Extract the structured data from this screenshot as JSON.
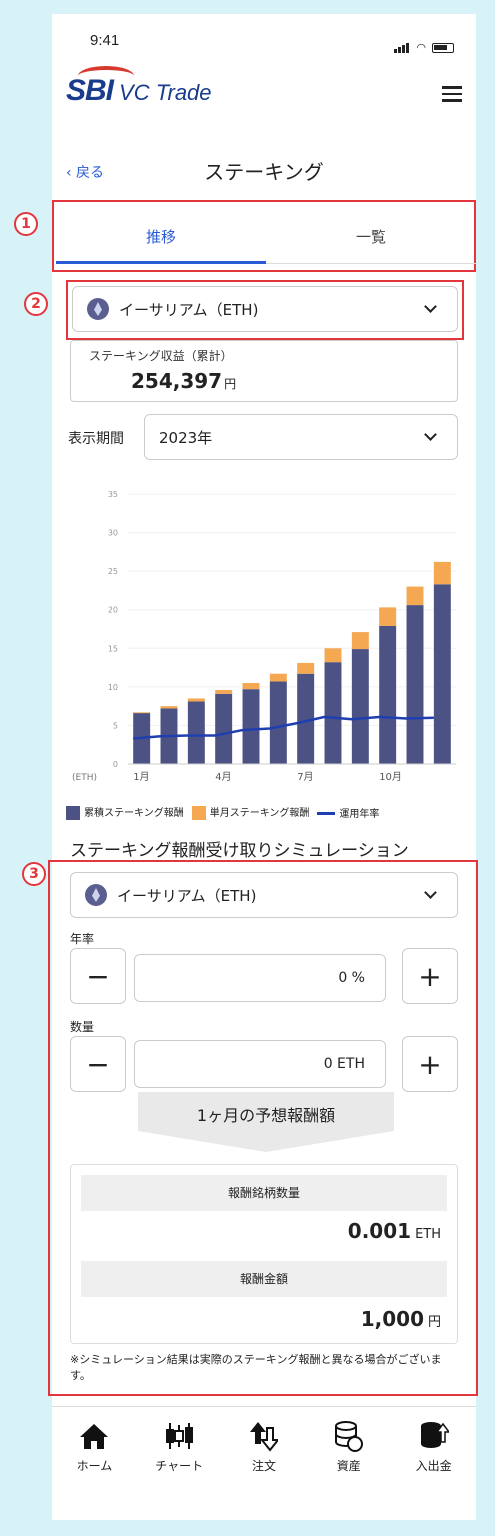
{
  "status": {
    "time": "9:41"
  },
  "header": {
    "logo_sbi": "SBI",
    "logo_product": "VC Trade"
  },
  "nav": {
    "back_label": "‹ 戻る",
    "title": "ステーキング"
  },
  "annotations": {
    "marker1": "1",
    "marker2": "2",
    "marker3": "3"
  },
  "tabs": [
    {
      "label": "推移"
    },
    {
      "label": "一覧"
    }
  ],
  "asset_select": {
    "value": "イーサリアム（ETH)"
  },
  "staking_reward": {
    "label": "ステーキング収益（累計）",
    "value": "254,397",
    "unit": "円"
  },
  "period": {
    "label": "表示期間",
    "value": "2023年"
  },
  "chart_data": {
    "type": "bar",
    "y_unit_label": "(ETH)",
    "ylim": [
      0,
      35
    ],
    "y_ticks": [
      0,
      5,
      10,
      15,
      20,
      25,
      30,
      35
    ],
    "categories": [
      "1月",
      "2月",
      "3月",
      "4月",
      "5月",
      "6月",
      "7月",
      "8月",
      "9月",
      "10月",
      "11月",
      "12月"
    ],
    "x_tick_labels": [
      "1月",
      "",
      "",
      "4月",
      "",
      "",
      "7月",
      "",
      "",
      "10月",
      "",
      ""
    ],
    "series": [
      {
        "name": "累積ステーキング報酬",
        "color": "#4c5283",
        "values": [
          6.6,
          7.2,
          8.1,
          9.1,
          9.7,
          10.7,
          11.7,
          13.2,
          14.9,
          17.9,
          20.6,
          23.3
        ]
      },
      {
        "name": "単月ステーキング報酬",
        "color": "#f4a851",
        "values": [
          0.1,
          0.3,
          0.4,
          0.5,
          0.8,
          1.0,
          1.4,
          1.8,
          2.2,
          2.4,
          2.4,
          2.9
        ]
      },
      {
        "name": "運用年率",
        "type": "line",
        "color": "#1f3fb0",
        "values": [
          3.3,
          3.6,
          3.7,
          3.7,
          4.4,
          4.6,
          5.3,
          6.1,
          5.8,
          6.1,
          5.9,
          6.0
        ]
      }
    ]
  },
  "simulation": {
    "title": "ステーキング報酬受け取りシミュレーション",
    "asset": "イーサリアム（ETH)",
    "rate_label": "年率",
    "rate_value": "0 %",
    "qty_label": "数量",
    "qty_value": "0 ETH",
    "minus": "−",
    "plus": "+",
    "estimate_label": "1ヶ月の予想報酬額",
    "reward_qty_label": "報酬銘柄数量",
    "reward_qty_value": "0.001",
    "reward_qty_unit": "ETH",
    "reward_amount_label": "報酬金額",
    "reward_amount_value": "1,000",
    "reward_amount_unit": "円",
    "disclaimer": "※シミュレーション結果は実際のステーキング報酬と異なる場合がございます。"
  },
  "bottom_nav": [
    {
      "label": "ホーム",
      "icon": "home-icon"
    },
    {
      "label": "チャート",
      "icon": "candlestick-chart-icon"
    },
    {
      "label": "注文",
      "icon": "order-arrows-icon"
    },
    {
      "label": "資産",
      "icon": "coins-assets-icon"
    },
    {
      "label": "入出金",
      "icon": "deposit-withdraw-icon"
    }
  ]
}
